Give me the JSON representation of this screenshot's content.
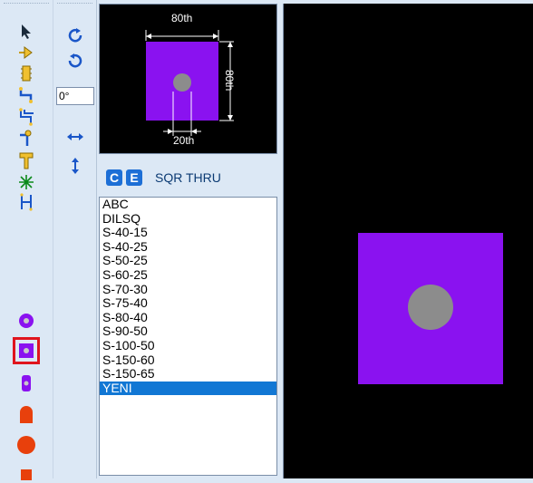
{
  "toolbar_left": {
    "tools": [
      {
        "icon": "pointer-arrow-icon"
      },
      {
        "icon": "component-arrow-icon"
      },
      {
        "icon": "package-icon"
      },
      {
        "icon": "wire-route-icon"
      },
      {
        "icon": "bus-route-icon"
      },
      {
        "icon": "pin-probe-icon"
      },
      {
        "icon": "t-junction-icon"
      },
      {
        "icon": "asterisk-marker-icon"
      },
      {
        "icon": "h-connector-icon"
      },
      {
        "icon": "round-pad-icon"
      },
      {
        "icon": "square-pad-icon"
      },
      {
        "icon": "oblong-pad-icon"
      },
      {
        "icon": "half-round-pad-icon"
      },
      {
        "icon": "circle-pad-icon"
      },
      {
        "icon": "square-small-pad-icon"
      }
    ],
    "selected_tool": "square-pad-icon"
  },
  "toolbar_right": {
    "rotate_cw_icon": "rotate-cw-icon",
    "rotate_ccw_icon": "rotate-ccw-icon",
    "angle_value": "0°",
    "flip_h_icon": "flip-horizontal-icon",
    "flip_v_icon": "flip-vertical-icon"
  },
  "preview": {
    "width_label": "80th",
    "height_label": "80th",
    "hole_label": "20th",
    "pad_color": "#8a12f0",
    "hole_color": "#8c8c8c"
  },
  "pad_header": {
    "badge_c": "C",
    "badge_e": "E",
    "title": "SQR THRU"
  },
  "pad_list": {
    "items": [
      "ABC",
      "DILSQ",
      "S-40-15",
      "S-40-25",
      "S-50-25",
      "S-60-25",
      "S-70-30",
      "S-75-40",
      "S-80-40",
      "S-90-50",
      "S-100-50",
      "S-150-60",
      "S-150-65",
      "YENI"
    ],
    "selected": "YENI"
  },
  "colors": {
    "accent": "#1177d4",
    "selection_outline": "#e0151e",
    "canvas_bg": "#000000"
  }
}
